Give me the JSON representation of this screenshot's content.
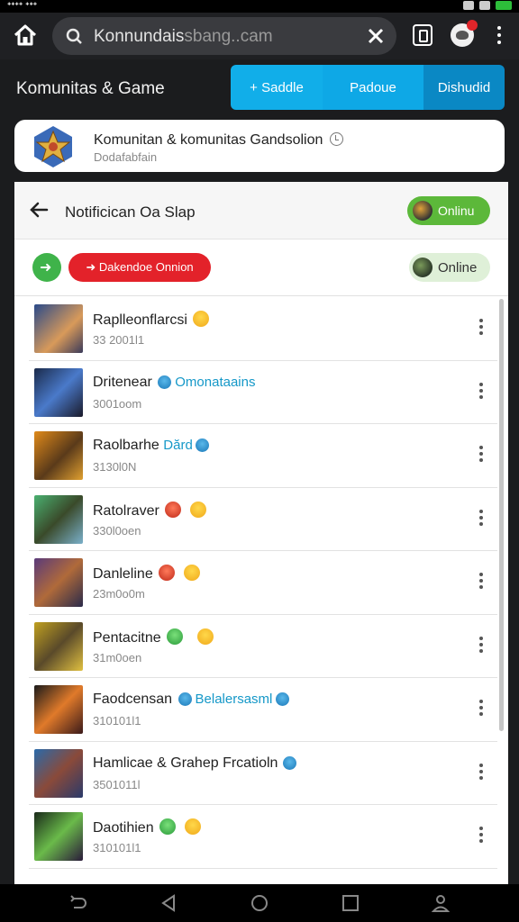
{
  "statusbar": {
    "left_text": "ᐩᐩᐩᐩ ᐩᐩᐩ"
  },
  "browser": {
    "url_main": "Konnundais",
    "url_dim": "sbang..cam",
    "tab_count_hint": ""
  },
  "subheader": {
    "title": "Komunitas & Game",
    "segments": [
      "+ Saddle",
      "Padoue",
      "Dishudid"
    ]
  },
  "card": {
    "name": "Komunitan & komunitas Gandsolion",
    "sub": "Dodafabfain"
  },
  "panel": {
    "title": "Notificican Oa Slap",
    "online_label": "Onlinu",
    "red_pill": "➜ Dakendoe Onnion",
    "online2_label": "Online"
  },
  "items": [
    {
      "name": "Raplleonflarcsi",
      "tag": "",
      "meta": "33 2001l1"
    },
    {
      "name": "Dritenear",
      "tag": "Omonataains",
      "meta": "3001oom"
    },
    {
      "name": "Raolbarhe",
      "tag": "Dărd",
      "meta": "3130l0N"
    },
    {
      "name": "Ratolraver",
      "tag": "",
      "meta": "330l0oen"
    },
    {
      "name": "Danleline",
      "tag": "",
      "meta": "23m0o0m"
    },
    {
      "name": "Pentacitne",
      "tag": "",
      "meta": "31m0oen"
    },
    {
      "name": "Faodcensan",
      "tag": "Belalersasml",
      "meta": "310101l1"
    },
    {
      "name": "Hamlicae & Grahep Frcatioln",
      "tag": "",
      "meta": "3501011l"
    },
    {
      "name": "Daotihien",
      "tag": "",
      "meta": "310101l1"
    }
  ],
  "colors": {
    "accent": "#11aee9",
    "online_green": "#5cb83a",
    "red": "#e3222a",
    "tag_blue": "#1598c8"
  }
}
